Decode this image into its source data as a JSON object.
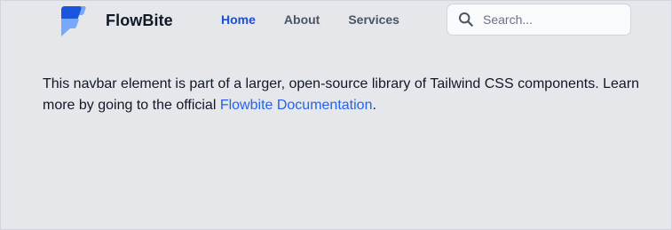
{
  "navbar": {
    "brand": {
      "name": "FlowBite",
      "logo_icon": "flowbite-logo-icon"
    },
    "links": [
      {
        "label": "Home",
        "active": true
      },
      {
        "label": "About",
        "active": false
      },
      {
        "label": "Services",
        "active": false
      }
    ],
    "search": {
      "icon": "search-icon",
      "placeholder": "Search...",
      "value": ""
    }
  },
  "content": {
    "text_before_link": "This navbar element is part of a larger, open-source library of Tailwind CSS components. Learn more by going to the official ",
    "link_text": "Flowbite Documentation",
    "text_after_link": "."
  },
  "colors": {
    "background": "#e5e7eb",
    "accent": "#1d4ed8",
    "link": "#2563eb",
    "logo_dark": "#1a56db",
    "logo_light": "#76a9fa"
  }
}
